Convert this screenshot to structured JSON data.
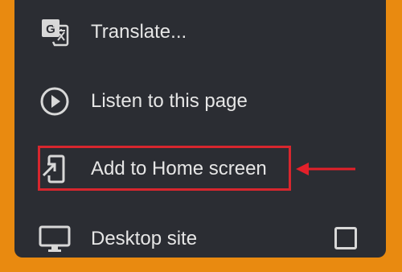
{
  "colors": {
    "frame": "#E98A10",
    "panel": "#2B2D33",
    "text": "#E6E6E6",
    "icon": "#D8D8D8",
    "highlight": "#D7262E",
    "arrow": "#E3202A"
  },
  "menu": {
    "items": [
      {
        "label": "Translate...",
        "icon": "translate-icon"
      },
      {
        "label": "Listen to this page",
        "icon": "play-circle-icon"
      },
      {
        "label": "Add to Home screen",
        "icon": "add-to-home-screen-icon"
      },
      {
        "label": "Desktop site",
        "icon": "desktop-monitor-icon",
        "checked": false
      }
    ]
  },
  "annotation": {
    "highlighted_item": "Add to Home screen",
    "arrow": "pointing-left"
  }
}
